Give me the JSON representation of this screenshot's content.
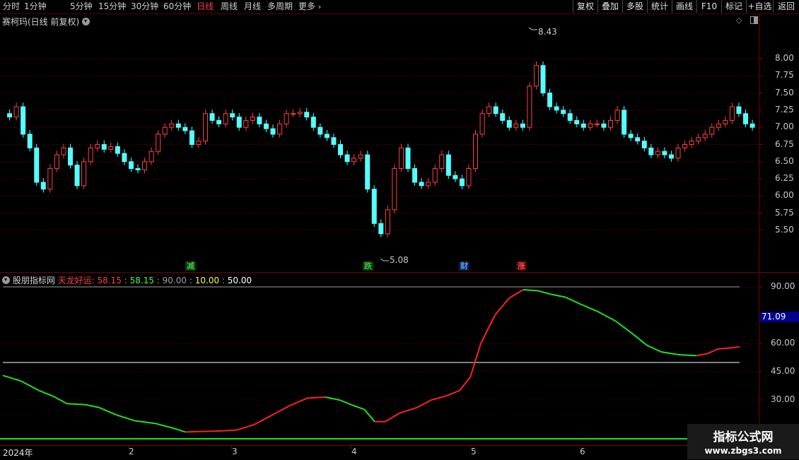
{
  "toolbar": {
    "periods": [
      "分时",
      "1分钟",
      "5分钟",
      "15分钟",
      "30分钟",
      "60分钟",
      "日线",
      "周线",
      "月线",
      "多周期",
      "更多"
    ],
    "active_period": "日线",
    "more_icon": "chevron-right-icon",
    "right_buttons": [
      "复权",
      "叠加",
      "多股",
      "统计",
      "画线",
      "F10",
      "标记",
      "+自选",
      "返回"
    ]
  },
  "price_panel": {
    "title": "赛柯玛(日线 前复权)",
    "price_axis": [
      "8.00",
      "7.75",
      "7.50",
      "7.25",
      "7.00",
      "6.75",
      "6.50",
      "6.25",
      "6.00",
      "5.75",
      "5.50"
    ],
    "high_label": "8.43",
    "low_label": "5.08",
    "signals": [
      {
        "text": "减",
        "color": "#3fbf3f"
      },
      {
        "text": "跌",
        "color": "#3fbf3f"
      },
      {
        "text": "财",
        "color": "#4aa0ff"
      },
      {
        "text": "涨",
        "color": "#ff4040"
      }
    ]
  },
  "indicator_panel": {
    "source": "股朋指标网",
    "name": "天龙好运:",
    "values": [
      {
        "text": "58.15",
        "color": "#ff4040"
      },
      {
        "text": "58.15",
        "color": "#40ff40"
      },
      {
        "text": "90.00",
        "color": "#a0a0a0"
      },
      {
        "text": "10.00",
        "color": "#ffff40"
      },
      {
        "text": "50.00",
        "color": "#ffffff"
      }
    ],
    "axis": [
      "90.00",
      "60.00",
      "45.00",
      "30.00"
    ],
    "current_value": "71.09"
  },
  "time_axis": {
    "labels": [
      "2024年",
      "2",
      "3",
      "4",
      "5",
      "6"
    ]
  },
  "watermark": {
    "line1": "指标公式网",
    "line2": "www.zbgs3.com"
  },
  "colors": {
    "up": "#ff4040",
    "down": "#54ffff",
    "grid": "#7a0000",
    "line_up": "#ff2020",
    "line_down": "#20e020"
  }
}
